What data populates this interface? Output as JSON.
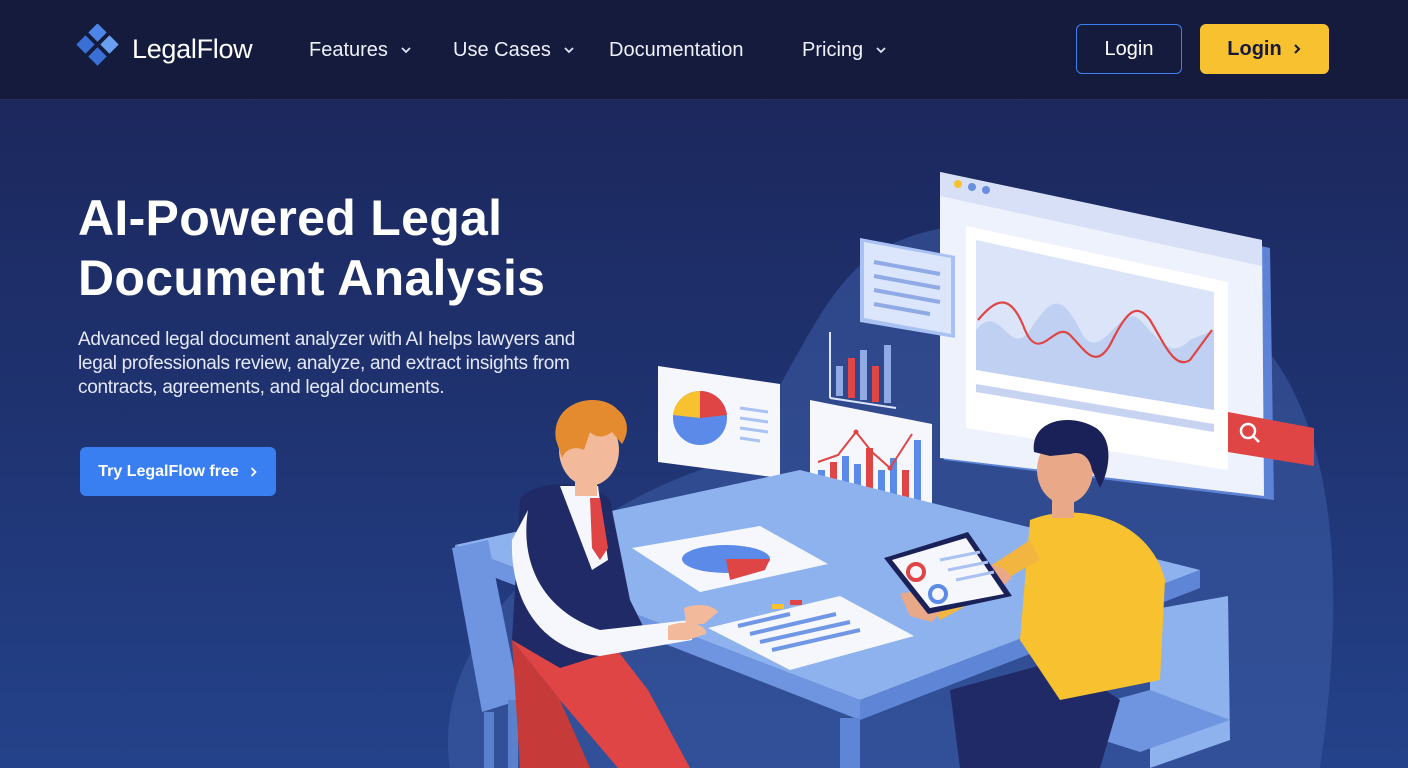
{
  "brand": {
    "name": "LegalFlow"
  },
  "nav": {
    "items": [
      {
        "label": "Features",
        "has_dropdown": true
      },
      {
        "label": "Use Cases",
        "has_dropdown": true
      },
      {
        "label": "Documentation",
        "has_dropdown": false
      },
      {
        "label": "Pricing",
        "has_dropdown": true
      }
    ],
    "login_label": "Login",
    "login_primary_label": "Login"
  },
  "hero": {
    "title_line1": "AI-Powered Legal",
    "title_line2": "Document Analysis",
    "subtitle": "Advanced legal document analyzer with AI helps lawyers and legal professionals review, analyze, and extract insights from contracts, agreements, and legal documents.",
    "cta_label": "Try LegalFlow free"
  },
  "colors": {
    "nav_background": "#141b3c",
    "hero_gradient_top": "#1b2457",
    "hero_gradient_bottom": "#24428a",
    "accent_yellow": "#f7c12f",
    "accent_blue": "#3a7ff2",
    "accent_red": "#e04545"
  },
  "icons": [
    "logo-diamond-icon",
    "chevron-down-icon",
    "chevron-right-icon",
    "search-icon"
  ]
}
